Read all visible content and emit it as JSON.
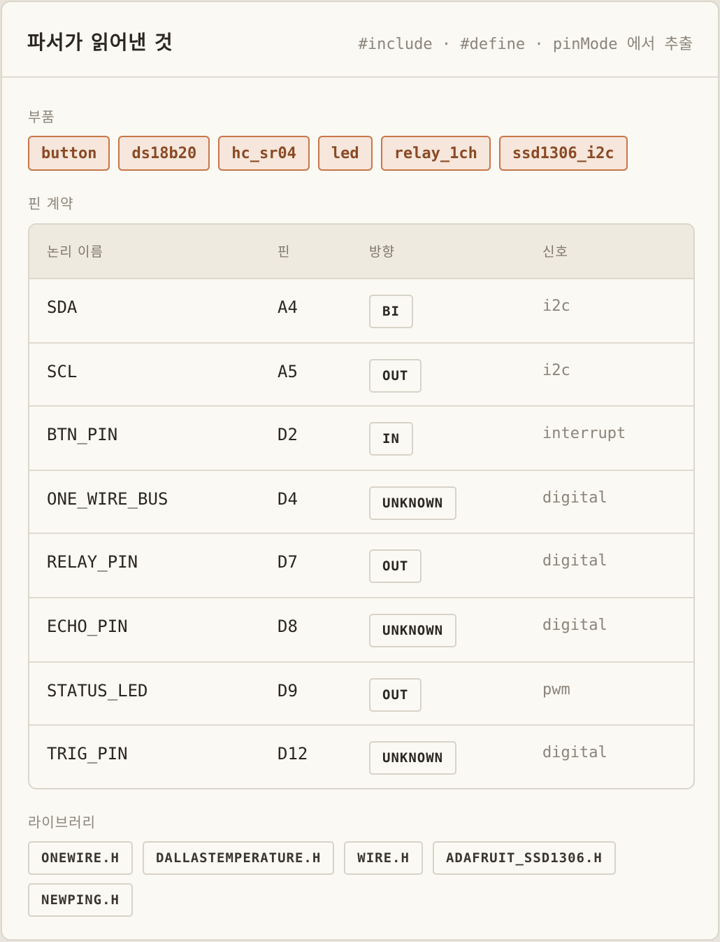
{
  "header": {
    "title": "파서가 읽어낸 것",
    "subtitle": "#include · #define · pinMode 에서 추출"
  },
  "components": {
    "label": "부품",
    "items": [
      "button",
      "ds18b20",
      "hc_sr04",
      "led",
      "relay_1ch",
      "ssd1306_i2c"
    ]
  },
  "pin_contract": {
    "label": "핀 계약",
    "columns": [
      "논리 이름",
      "핀",
      "방향",
      "신호"
    ],
    "rows": [
      {
        "name": "SDA",
        "pin": "A4",
        "direction": "BI",
        "signal": "i2c"
      },
      {
        "name": "SCL",
        "pin": "A5",
        "direction": "OUT",
        "signal": "i2c"
      },
      {
        "name": "BTN_PIN",
        "pin": "D2",
        "direction": "IN",
        "signal": "interrupt"
      },
      {
        "name": "ONE_WIRE_BUS",
        "pin": "D4",
        "direction": "UNKNOWN",
        "signal": "digital"
      },
      {
        "name": "RELAY_PIN",
        "pin": "D7",
        "direction": "OUT",
        "signal": "digital"
      },
      {
        "name": "ECHO_PIN",
        "pin": "D8",
        "direction": "UNKNOWN",
        "signal": "digital"
      },
      {
        "name": "STATUS_LED",
        "pin": "D9",
        "direction": "OUT",
        "signal": "pwm"
      },
      {
        "name": "TRIG_PIN",
        "pin": "D12",
        "direction": "UNKNOWN",
        "signal": "digital"
      }
    ]
  },
  "libraries": {
    "label": "라이브러리",
    "items": [
      "ONEWIRE.H",
      "DALLASTEMPERATURE.H",
      "WIRE.H",
      "ADAFRUIT_SSD1306.H",
      "NEWPING.H"
    ]
  },
  "colors": {
    "accent": "#c8764a",
    "chip_bg": "#f6e6db",
    "background": "#fbf9f3"
  }
}
